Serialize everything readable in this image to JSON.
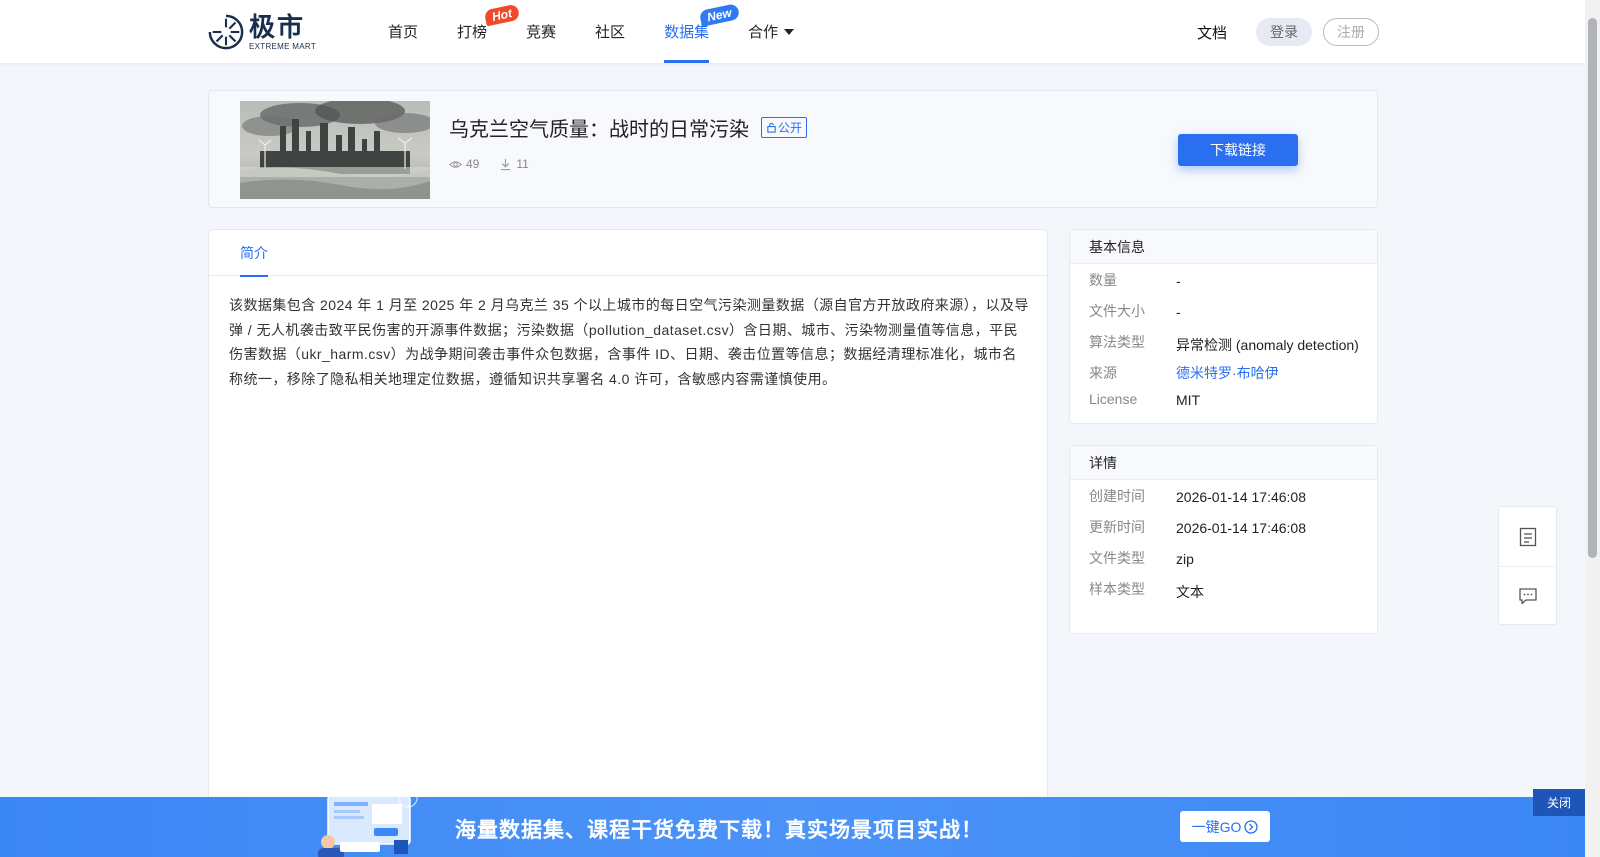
{
  "logo": {
    "cn": "极市",
    "en": "EXTREME MART"
  },
  "nav": {
    "items": [
      {
        "label": "首页"
      },
      {
        "label": "打榜",
        "badge": "Hot"
      },
      {
        "label": "竞赛"
      },
      {
        "label": "社区"
      },
      {
        "label": "数据集",
        "badge": "New",
        "active": true
      },
      {
        "label": "合作"
      }
    ]
  },
  "header": {
    "docs": "文档",
    "login": "登录",
    "register": "注册"
  },
  "dataset": {
    "title": "乌克兰空气质量：战时的日常污染",
    "visibility": "公开",
    "views": "49",
    "downloads": "11",
    "download_label": "下载链接"
  },
  "intro": {
    "tab": "简介",
    "text": "该数据集包含 2024 年 1 月至 2025 年 2 月乌克兰 35 个以上城市的每日空气污染测量数据（源自官方开放政府来源），以及导弹 / 无人机袭击致平民伤害的开源事件数据；污染数据（pollution_dataset.csv）含日期、城市、污染物测量值等信息，平民伤害数据（ukr_harm.csv）为战争期间袭击事件众包数据，含事件 ID、日期、袭击位置等信息；数据经清理标准化，城市名称统一，移除了隐私相关地理定位数据，遵循知识共享署名 4.0 许可，含敏感内容需谨慎使用。"
  },
  "basic_info": {
    "heading": "基本信息",
    "rows": [
      {
        "label": "数量",
        "value": "-"
      },
      {
        "label": "文件大小",
        "value": "-"
      },
      {
        "label": "算法类型",
        "value": "异常检测 (anomaly detection)"
      },
      {
        "label": "来源",
        "value": "德米特罗·布哈伊"
      },
      {
        "label": "License",
        "value": "MIT"
      }
    ]
  },
  "details": {
    "heading": "详情",
    "rows": [
      {
        "label": "创建时间",
        "value": "2026-01-14 17:46:08"
      },
      {
        "label": "更新时间",
        "value": "2026-01-14 17:46:08"
      },
      {
        "label": "文件类型",
        "value": "zip"
      },
      {
        "label": "样本类型",
        "value": "文本"
      }
    ]
  },
  "banner": {
    "text": "海量数据集、课程干货免费下载！真实场景项目实战！",
    "go": "一键GO",
    "close": "关闭"
  },
  "colors": {
    "accent": "#2a6ff0",
    "hot": "#f04a2a",
    "banner": "#3b87f5"
  }
}
